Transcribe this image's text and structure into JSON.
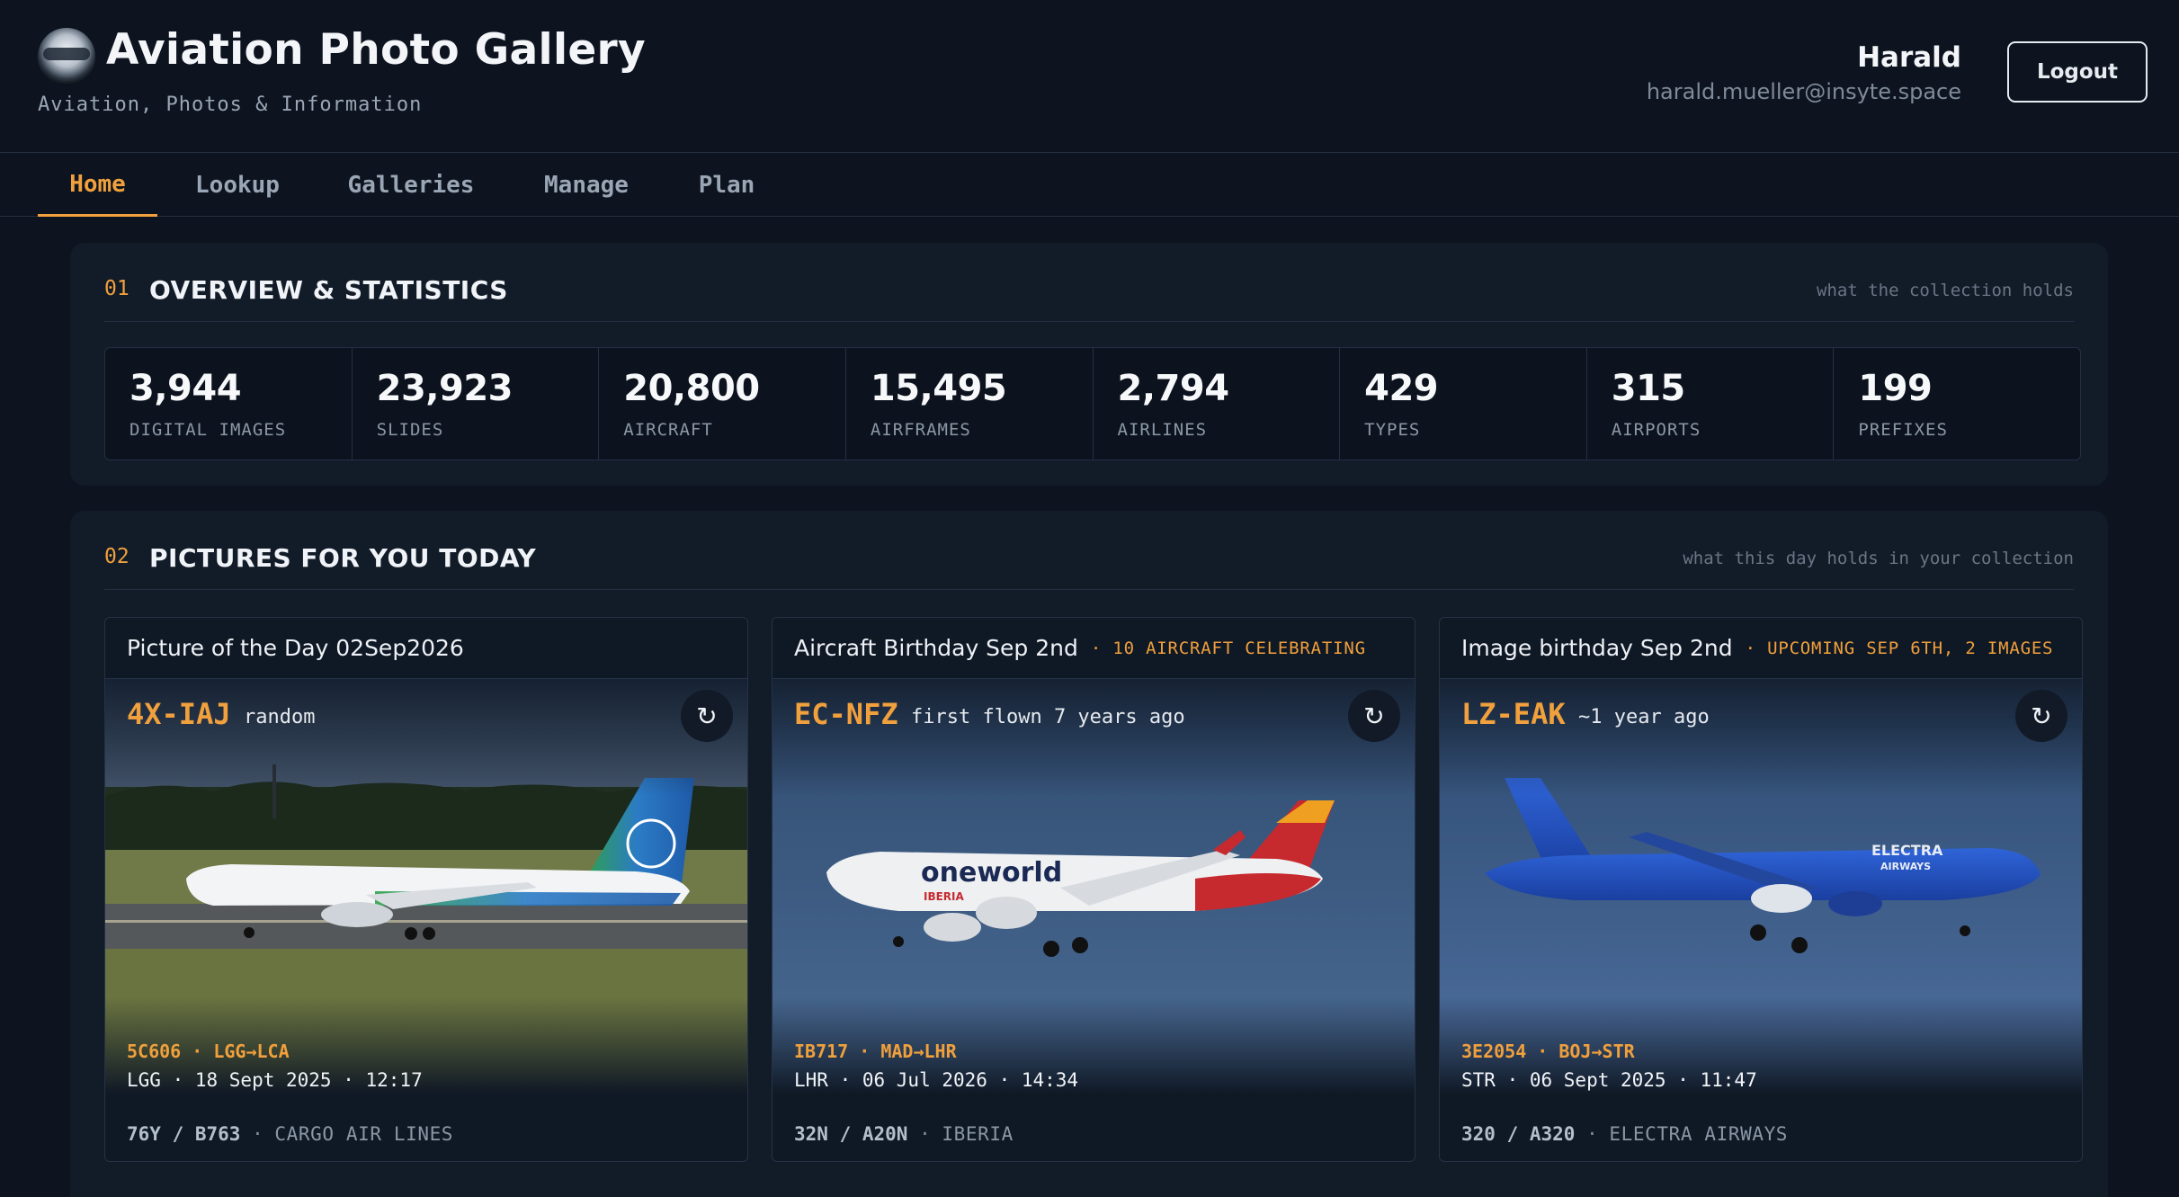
{
  "header": {
    "title": "Aviation Photo Gallery",
    "subtitle": "Aviation, Photos & Information",
    "user_name": "Harald",
    "user_email": "harald.mueller@insyte.space",
    "logout_label": "Logout"
  },
  "nav": {
    "tabs": [
      {
        "label": "Home",
        "active": true
      },
      {
        "label": "Lookup",
        "active": false
      },
      {
        "label": "Galleries",
        "active": false
      },
      {
        "label": "Manage",
        "active": false
      },
      {
        "label": "Plan",
        "active": false
      }
    ]
  },
  "overview": {
    "num": "01",
    "title": "OVERVIEW & STATISTICS",
    "note": "what the collection holds",
    "stats": [
      {
        "value": "3,944",
        "label": "DIGITAL IMAGES"
      },
      {
        "value": "23,923",
        "label": "SLIDES"
      },
      {
        "value": "20,800",
        "label": "AIRCRAFT"
      },
      {
        "value": "15,495",
        "label": "AIRFRAMES"
      },
      {
        "value": "2,794",
        "label": "AIRLINES"
      },
      {
        "value": "429",
        "label": "TYPES"
      },
      {
        "value": "315",
        "label": "AIRPORTS"
      },
      {
        "value": "199",
        "label": "PREFIXES"
      }
    ]
  },
  "today": {
    "num": "02",
    "title": "PICTURES FOR YOU TODAY",
    "note": "what this day holds in your collection",
    "cards": [
      {
        "title": "Picture of the Day 02Sep2026",
        "note": "",
        "registration": "4X-IAJ",
        "reg_note": "random",
        "flight": "5C606 · LGG→LCA",
        "when": "LGG · 18 Sept 2025 · 12:17",
        "type": "76Y / B763",
        "sep": "·",
        "airline": "CARGO AIR LINES",
        "refresh_icon": "refresh-icon"
      },
      {
        "title": "Aircraft Birthday Sep 2nd",
        "note": "· 10 AIRCRAFT CELEBRATING",
        "registration": "EC-NFZ",
        "reg_note": "first flown 7 years ago",
        "flight": "IB717 · MAD→LHR",
        "when": "LHR · 06 Jul 2026 · 14:34",
        "type": "32N / A20N",
        "sep": "·",
        "airline": "IBERIA",
        "livery_text": "oneworld",
        "livery_sub": "IBERIA",
        "refresh_icon": "refresh-icon"
      },
      {
        "title": "Image birthday Sep 2nd",
        "note": "· UPCOMING SEP 6TH, 2 IMAGES",
        "registration": "LZ-EAK",
        "reg_note": "~1 year ago",
        "flight": "3E2054 · BOJ→STR",
        "when": "STR · 06 Sept 2025 · 11:47",
        "type": "320 / A320",
        "sep": "·",
        "airline": "ELECTRA AIRWAYS",
        "livery_text": "ELECTRA",
        "livery_sub": "AIRWAYS",
        "refresh_icon": "refresh-icon"
      }
    ]
  },
  "colors": {
    "accent": "#f0a03c",
    "background": "#0d1420",
    "panel": "#121b28"
  }
}
